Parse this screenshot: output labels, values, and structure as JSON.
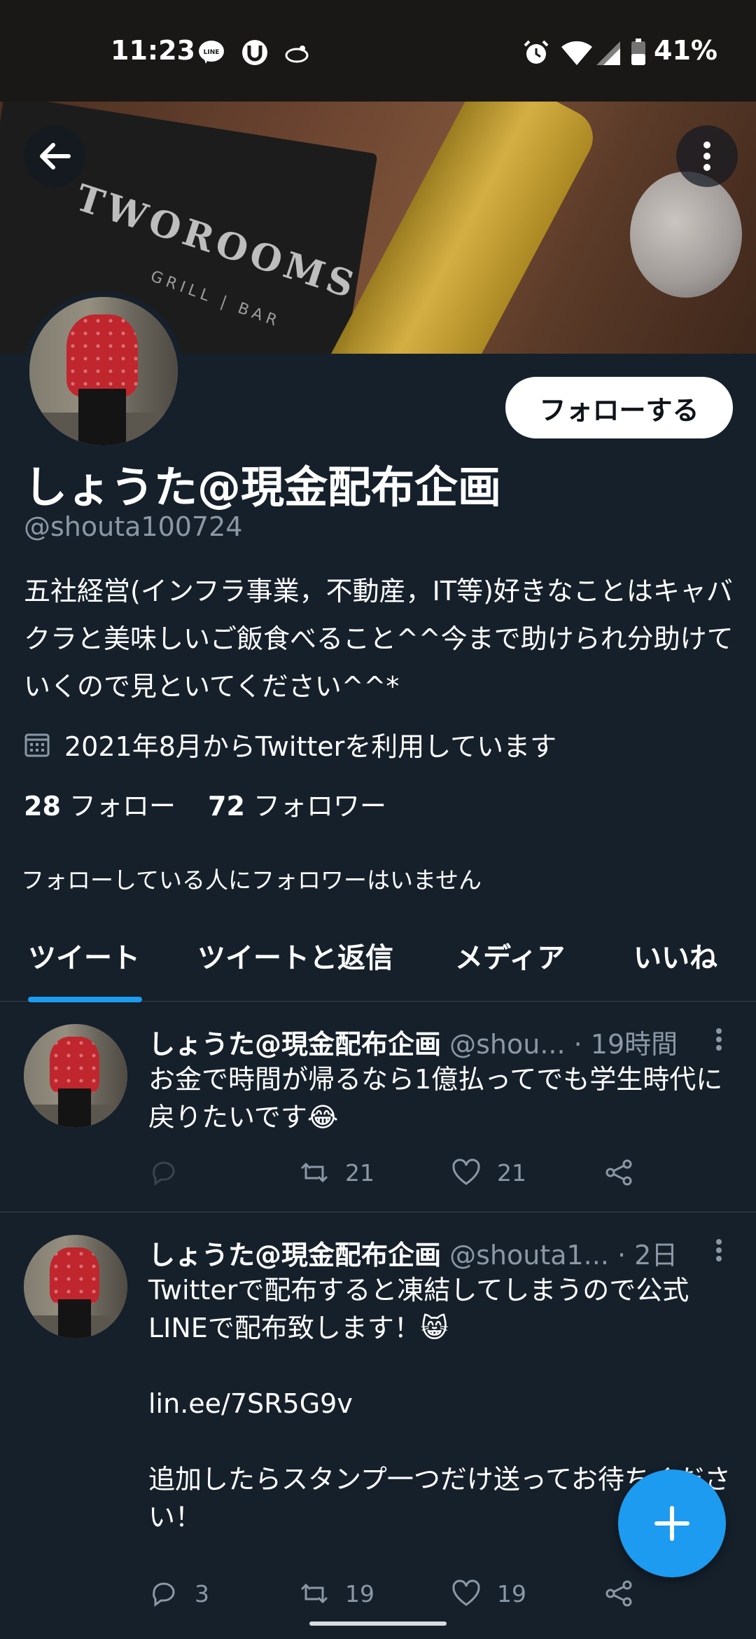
{
  "status_bar": {
    "time": "11:23",
    "battery": "41%",
    "icons": [
      "line-icon",
      "utorrent-icon",
      "bird-icon",
      "alarm-icon",
      "wifi-icon",
      "signal-icon",
      "battery-icon"
    ]
  },
  "banner": {
    "book_text": "TWOROOMS",
    "book_sub": "GRILL | BAR"
  },
  "profile": {
    "follow_label": "フォローする",
    "display_name": "しょうた@現金配布企画",
    "handle": "@shouta100724",
    "bio": "五社経営(インフラ事業，不動産，IT等)好きなことはキャバクラと美味しいご飯食べること^^今まで助けられ分助けていくので見といてください^^*",
    "joined": "2021年8月からTwitterを利用しています",
    "following_count": "28",
    "following_label": "フォロー",
    "followers_count": "72",
    "followers_label": "フォロワー",
    "no_followers_note": "フォローしている人にフォロワーはいません"
  },
  "tabs": [
    {
      "label": "ツイート",
      "active": true
    },
    {
      "label": "ツイートと返信",
      "active": false
    },
    {
      "label": "メディア",
      "active": false
    },
    {
      "label": "いいね",
      "active": false
    }
  ],
  "tweets": [
    {
      "name": "しょうた@現金配布企画",
      "meta": "@shou... · 19時間",
      "body": "お金で時間が帰るなら1億払ってでも学生時代に戻りたいです😂",
      "replies": "",
      "retweets": "21",
      "likes": "21"
    },
    {
      "name": "しょうた@現金配布企画",
      "meta": "@shouta1... · 2日",
      "body": "Twitterで配布すると凍結してしまうので公式LINEで配布致します！😸\n\nlin.ee/7SR5G9v\n\n追加したらスタンプ一つだけ送ってお待ちください！",
      "replies": "3",
      "retweets": "19",
      "likes": "19"
    }
  ],
  "colors": {
    "background": "#15202b",
    "accent": "#1d9bf0",
    "secondary_text": "#8b98a5",
    "divider": "#38444d"
  }
}
